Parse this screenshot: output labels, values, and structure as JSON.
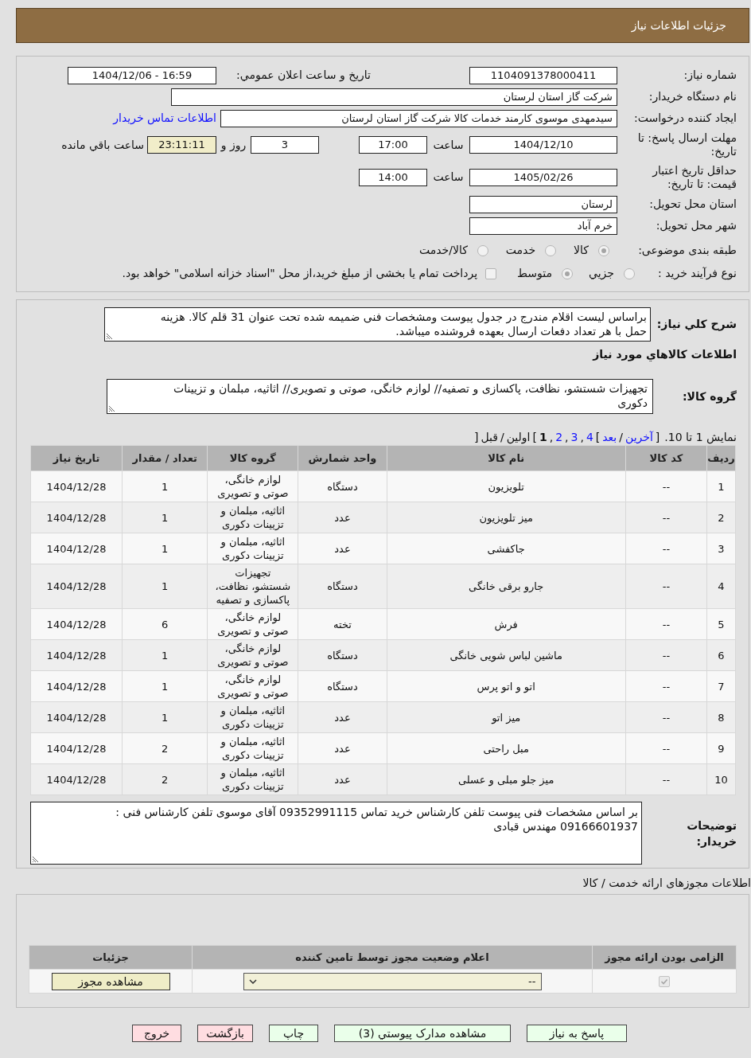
{
  "header": {
    "title": "جزئیات اطلاعات نیاز"
  },
  "need_details": {
    "number": {
      "label": "شماره نیاز:",
      "value": "1104091378000411"
    },
    "announcement": {
      "label": "تاریخ و ساعت اعلان عمومي:",
      "value": "1404/12/06 - 16:59"
    },
    "buyer_org": {
      "label": "نام دستگاه خريدار:",
      "value": "شرکت گاز استان لرستان"
    },
    "requester": {
      "label": "ایجاد کننده درخواست:",
      "value": "سیدمهدی موسوی کارمند خدمات کالا شرکت گاز استان لرستان",
      "contact_link": "اطلاعات تماس خریدار"
    },
    "reply_deadline": {
      "label": "مهلت ارسال پاسخ: تا تاریخ:",
      "date": "1404/12/10",
      "time_label": "ساعت",
      "time": "17:00",
      "days": "3",
      "days_label": "روز و",
      "remaining": "23:11:11",
      "remaining_label": "ساعت باقي مانده"
    },
    "price_validity": {
      "label": "حداقل تاریخ اعتبار قیمت: تا تاریخ:",
      "date": "1405/02/26",
      "time_label": "ساعت",
      "time": "14:00"
    },
    "delivery_province": {
      "label": "استان محل تحویل:",
      "value": "لرستان"
    },
    "delivery_city": {
      "label": "شهر محل تحویل:",
      "value": "خرم آباد"
    },
    "subject_category": {
      "label": "طبقه بندی موضوعی:",
      "options": [
        {
          "label": "کالا",
          "selected": true
        },
        {
          "label": "خدمت",
          "selected": false
        },
        {
          "label": "کالا/خدمت",
          "selected": false
        }
      ]
    },
    "purchase_process": {
      "label": "نوع فرآیند خرید :",
      "options": [
        {
          "label": "جزيي",
          "selected": false
        },
        {
          "label": "متوسط",
          "selected": true
        }
      ],
      "treasury_payment": {
        "label": "پرداخت تمام یا بخشی از مبلغ خرید،از محل \"اسناد خزانه اسلامی\" خواهد بود.",
        "checked": false
      }
    }
  },
  "description": {
    "label": "شرح کلي نیاز:",
    "value": "براساس لیست اقلام مندرج در جدول پیوست ومشخصات فنی ضمیمه شده تحت عنوان 31 قلم کالا. هزینه حمل با هر تعداد دفعات ارسال بعهده فروشنده میباشد."
  },
  "goods_section": {
    "title": "اطلاعات کالاهاي مورد نیاز"
  },
  "goods_group": {
    "label": "گروه کالا:",
    "value": "تجهیزات شستشو، نظافت، پاکسازی و تصفیه// لوازم خانگی، صوتی و تصویری// اثاثیه، مبلمان و تزیینات دکوری"
  },
  "pagination": {
    "summary": "نمایش 1 تا 10.",
    "tokens": [
      {
        "kind": "separator",
        "text": "["
      },
      {
        "kind": "nav",
        "text": "آخرین",
        "enabled": true
      },
      {
        "kind": "separator",
        "text": "/"
      },
      {
        "kind": "nav",
        "text": "بعد",
        "enabled": true
      },
      {
        "kind": "separator",
        "text": "]"
      },
      {
        "kind": "page",
        "text": "4",
        "selected": false
      },
      {
        "kind": "separator",
        "text": ","
      },
      {
        "kind": "page",
        "text": "3",
        "selected": false
      },
      {
        "kind": "separator",
        "text": ","
      },
      {
        "kind": "page",
        "text": "2",
        "selected": false
      },
      {
        "kind": "separator",
        "text": ","
      },
      {
        "kind": "page",
        "text": "1",
        "selected": true
      },
      {
        "kind": "separator",
        "text": "]"
      },
      {
        "kind": "nav",
        "text": "اولین",
        "enabled": false
      },
      {
        "kind": "separator",
        "text": "/"
      },
      {
        "kind": "nav",
        "text": "قبل",
        "enabled": false
      },
      {
        "kind": "separator",
        "text": "["
      }
    ]
  },
  "items_table": {
    "columns": [
      "ردیف",
      "کد کالا",
      "نام کالا",
      "واحد شمارش",
      "گروه کالا",
      "تعداد / مقدار",
      "تاریخ نیاز"
    ],
    "rows": [
      [
        "1",
        "--",
        "تلویزیون",
        "دستگاه",
        "لوازم خانگی، صوتی و تصویری",
        "1",
        "1404/12/28"
      ],
      [
        "2",
        "--",
        "میز تلویزیون",
        "عدد",
        "اثاثیه، مبلمان و تزیینات دکوری",
        "1",
        "1404/12/28"
      ],
      [
        "3",
        "--",
        "جاکفشی",
        "عدد",
        "اثاثیه، مبلمان و تزیینات دکوری",
        "1",
        "1404/12/28"
      ],
      [
        "4",
        "--",
        "جارو برقی خانگی",
        "دستگاه",
        "تجهیزات شستشو، نظافت، پاکسازی و تصفیه",
        "1",
        "1404/12/28"
      ],
      [
        "5",
        "--",
        "فرش",
        "تخته",
        "لوازم خانگی، صوتی و تصویری",
        "6",
        "1404/12/28"
      ],
      [
        "6",
        "--",
        "ماشین لباس شویی خانگی",
        "دستگاه",
        "لوازم خانگی، صوتی و تصویری",
        "1",
        "1404/12/28"
      ],
      [
        "7",
        "--",
        "اتو و اتو پرس",
        "دستگاه",
        "لوازم خانگی، صوتی و تصویری",
        "1",
        "1404/12/28"
      ],
      [
        "8",
        "--",
        "میز اتو",
        "عدد",
        "اثاثیه، مبلمان و تزیینات دکوری",
        "1",
        "1404/12/28"
      ],
      [
        "9",
        "--",
        "مبل راحتی",
        "عدد",
        "اثاثیه، مبلمان و تزیینات دکوری",
        "2",
        "1404/12/28"
      ],
      [
        "10",
        "--",
        "میز جلو مبلی و عسلی",
        "عدد",
        "اثاثیه، مبلمان و تزیینات دکوری",
        "2",
        "1404/12/28"
      ]
    ]
  },
  "buyer_notes": {
    "label": "توضیحات خریدار:",
    "value": "بر اساس مشخصات فنی پیوست تلفن کارشناس خرید تماس 09352991115 آقای موسوی تلفن کارشناس فنی : 09166601937 مهندس قبادی"
  },
  "licenses": {
    "title": "اطلاعات مجوزهای ارائه خدمت / کالا",
    "columns": [
      "الزامی بودن ارائه مجوز",
      "اعلام وضعیت مجوز توسط تامین کننده",
      "جزئیات"
    ],
    "rows": [
      {
        "required": true,
        "status": "--",
        "details_button": "مشاهده مجوز"
      }
    ]
  },
  "buttons": [
    {
      "label": "پاسخ به نیاز",
      "kind": "confirm"
    },
    {
      "label": "مشاهده مدارک پیوستي (3)",
      "kind": "confirm"
    },
    {
      "label": "چاپ",
      "kind": "confirm"
    },
    {
      "label": "بازگشت",
      "kind": "cancel"
    },
    {
      "label": "خروج",
      "kind": "cancel"
    }
  ]
}
